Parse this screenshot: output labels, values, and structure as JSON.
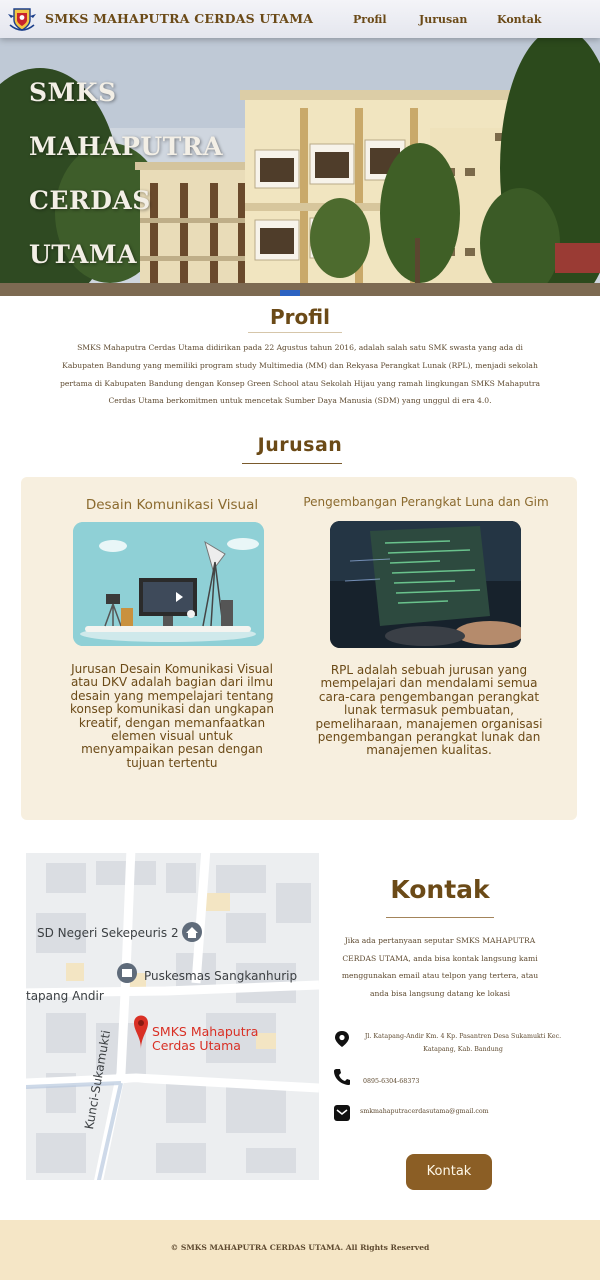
{
  "navbar": {
    "brand": "SMKS MAHAPUTRA CERDAS UTAMA",
    "links": [
      "Profil",
      "Jurusan",
      "Kontak"
    ],
    "logo_icon": "school-crest-icon"
  },
  "hero": {
    "title_lines": [
      "SMKS",
      "MAHAPUTRA",
      "CERDAS",
      "UTAMA"
    ]
  },
  "profil": {
    "title": "Profil",
    "text": "SMKS Mahaputra Cerdas Utama didirikan pada 22 Agustus tahun 2016, adalah salah satu SMK swasta yang ada di Kabupaten Bandung yang memiliki program study Multimedia (MM) dan Rekyasa Perangkat Lunak (RPL), menjadi sekolah pertama di Kabupaten Bandung dengan Konsep Green School atau Sekolah Hijau yang ramah lingkungan SMKS Mahaputra Cerdas Utama berkomitmen untuk mencetak Sumber Daya Manusia (SDM) yang unggul di era 4.0."
  },
  "jurusan": {
    "title": "Jurusan",
    "items": [
      {
        "name": "Desain Komunikasi Visual",
        "desc": "Jurusan Desain Komunikasi Visual atau DKV adalah bagian dari ilmu desain yang mempelajari tentang konsep komunikasi dan ungkapan kreatif, dengan memanfaatkan elemen visual untuk menyampaikan pesan dengan tujuan tertentu"
      },
      {
        "name": "Pengembangan Perangkat Luna dan Gim",
        "desc": "RPL adalah sebuah jurusan yang mempelajari dan mendalami semua cara-cara pengembangan perangkat lunak termasuk pembuatan, pemeliharaan, manajemen organisasi pengembangan perangkat lunak dan manajemen kualitas."
      }
    ]
  },
  "map": {
    "labels": {
      "school_a": "SD Negeri Sekepeuris 2",
      "clinic": "Puskesmas Sangkanhurip",
      "street_1": "tapang Andir",
      "street_2": "Kunci-Sukamukti",
      "pin_line1": "SMKS Mahaputra",
      "pin_line2": "Cerdas Utama"
    }
  },
  "kontak": {
    "title": "Kontak",
    "text": "Jika ada pertanyaan seputar SMKS MAHAPUTRA CERDAS UTAMA, anda bisa kontak langsung kami menggunakan email atau telpon yang tertera, atau anda bisa langsung datang ke lokasi",
    "address": "Jl. Katapang-Andir Km. 4 Kp. Pasantren Desa Sukamukti Kec. Katapang, Kab. Bandung",
    "phone": "0895-6304-68373",
    "email": "smkmahaputracerdasutama@gmail.com",
    "button": "Kontak"
  },
  "footer": {
    "text": "© SMKS MAHAPUTRA CERDAS UTAMA. All Rights Reserved"
  },
  "colors": {
    "brand_brown": "#6b4a17",
    "button_brown": "#8b5e25",
    "card_cream": "#f7efdf",
    "footer_cream": "#f5e6c6",
    "map_pin_red": "#d93025"
  }
}
